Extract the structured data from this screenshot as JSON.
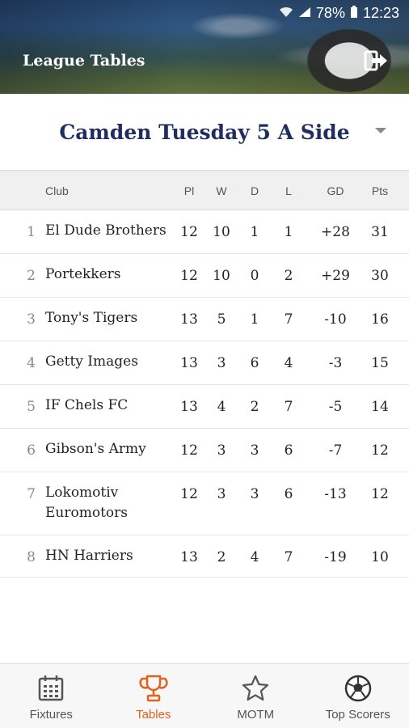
{
  "status_bar": {
    "battery": "78%",
    "time": "12:23"
  },
  "header": {
    "title": "League Tables"
  },
  "league": {
    "name": "Camden Tuesday 5 A Side"
  },
  "table": {
    "columns": {
      "club": "Club",
      "pl": "Pl",
      "w": "W",
      "d": "D",
      "l": "L",
      "gd": "GD",
      "pts": "Pts"
    },
    "rows": [
      {
        "pos": "1",
        "club": "El Dude Brothers",
        "pl": "12",
        "w": "10",
        "d": "1",
        "l": "1",
        "gd": "+28",
        "pts": "31"
      },
      {
        "pos": "2",
        "club": "Portekkers",
        "pl": "12",
        "w": "10",
        "d": "0",
        "l": "2",
        "gd": "+29",
        "pts": "30"
      },
      {
        "pos": "3",
        "club": "Tony's Tigers",
        "pl": "13",
        "w": "5",
        "d": "1",
        "l": "7",
        "gd": "-10",
        "pts": "16"
      },
      {
        "pos": "4",
        "club": "Getty Images",
        "pl": "13",
        "w": "3",
        "d": "6",
        "l": "4",
        "gd": "-3",
        "pts": "15"
      },
      {
        "pos": "5",
        "club": "IF Chels FC",
        "pl": "13",
        "w": "4",
        "d": "2",
        "l": "7",
        "gd": "-5",
        "pts": "14"
      },
      {
        "pos": "6",
        "club": "Gibson's Army",
        "pl": "12",
        "w": "3",
        "d": "3",
        "l": "6",
        "gd": "-7",
        "pts": "12"
      },
      {
        "pos": "7",
        "club_line1": "Lokomotiv",
        "club_line2": "Euromotors",
        "pl": "12",
        "w": "3",
        "d": "3",
        "l": "6",
        "gd": "-13",
        "pts": "12"
      },
      {
        "pos": "8",
        "club": "HN Harriers",
        "pl": "13",
        "w": "2",
        "d": "4",
        "l": "7",
        "gd": "-19",
        "pts": "10"
      }
    ]
  },
  "nav": {
    "items": [
      {
        "label": "Fixtures",
        "icon": "calendar-icon"
      },
      {
        "label": "Tables",
        "icon": "trophy-icon",
        "active": true
      },
      {
        "label": "MOTM",
        "icon": "star-icon"
      },
      {
        "label": "Top Scorers",
        "icon": "football-icon"
      }
    ],
    "active_color": "#e2621b"
  },
  "colors": {
    "league_title": "#1f2e5f",
    "accent": "#e2621b"
  }
}
